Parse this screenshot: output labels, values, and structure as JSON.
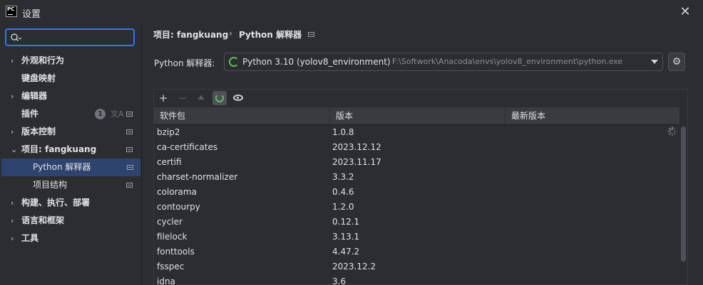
{
  "window": {
    "title": "设置",
    "logo": "PC"
  },
  "search": {
    "placeholder": "",
    "value": ""
  },
  "sidebar": {
    "items": [
      {
        "label": "外观和行为",
        "arrow": "›",
        "bold": true
      },
      {
        "label": "键盘映射",
        "bold": true
      },
      {
        "label": "编辑器",
        "arrow": "›",
        "bold": true
      },
      {
        "label": "插件",
        "bold": true,
        "badge": "1"
      },
      {
        "label": "版本控制",
        "arrow": "›",
        "bold": true
      },
      {
        "label": "项目: fangkuang",
        "arrow": "⌄",
        "bold": true
      },
      {
        "label": "Python 解释器",
        "bold": false,
        "selected": true
      },
      {
        "label": "项目结构",
        "bold": false
      },
      {
        "label": "构建、执行、部署",
        "arrow": "›",
        "bold": true
      },
      {
        "label": "语言和框架",
        "arrow": "›",
        "bold": true
      },
      {
        "label": "工具",
        "arrow": "›",
        "bold": true
      }
    ]
  },
  "breadcrumb": {
    "project": "项目: fangkuang",
    "separator": "›",
    "page": "Python 解释器"
  },
  "interpreter": {
    "label": "Python 解释器:",
    "name": "Python 3.10 (yolov8_environment)",
    "path": "F:\\Softwork\\Anacoda\\envs\\yolov8_environment\\python.exe"
  },
  "toolbar": {
    "add": "+",
    "remove": "−"
  },
  "table": {
    "columns": [
      "软件包",
      "版本",
      "最新版本"
    ],
    "rows": [
      {
        "name": "bzip2",
        "version": "1.0.8",
        "latest": ""
      },
      {
        "name": "ca-certificates",
        "version": "2023.12.12",
        "latest": ""
      },
      {
        "name": "certifi",
        "version": "2023.11.17",
        "latest": ""
      },
      {
        "name": "charset-normalizer",
        "version": "3.3.2",
        "latest": ""
      },
      {
        "name": "colorama",
        "version": "0.4.6",
        "latest": ""
      },
      {
        "name": "contourpy",
        "version": "1.2.0",
        "latest": ""
      },
      {
        "name": "cycler",
        "version": "0.12.1",
        "latest": ""
      },
      {
        "name": "filelock",
        "version": "3.13.1",
        "latest": ""
      },
      {
        "name": "fonttools",
        "version": "4.47.2",
        "latest": ""
      },
      {
        "name": "fsspec",
        "version": "2023.12.2",
        "latest": ""
      },
      {
        "name": "idna",
        "version": "3.6",
        "latest": ""
      }
    ]
  },
  "colors": {
    "accent": "#3574f0",
    "selection": "#2e436e",
    "success": "#5fb85f"
  }
}
